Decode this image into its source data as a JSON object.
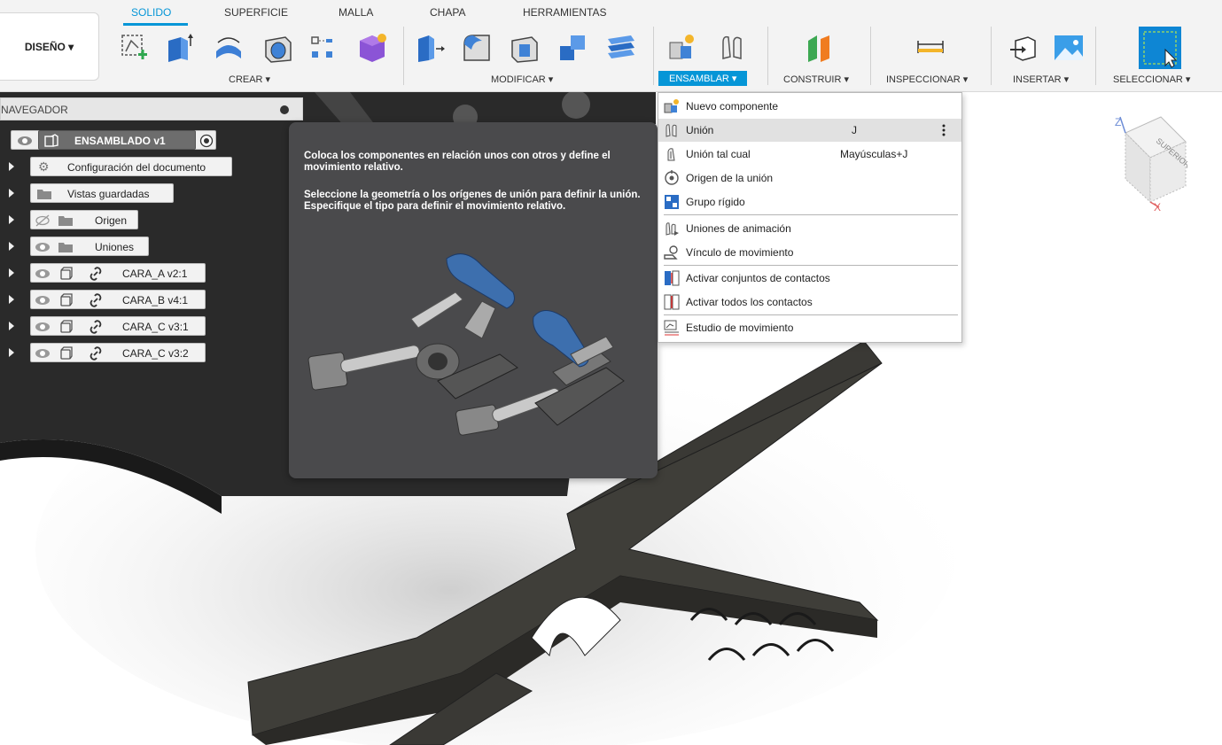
{
  "tabs": [
    {
      "id": "solido",
      "label": "SOLIDO",
      "active": true
    },
    {
      "id": "superficie",
      "label": "SUPERFICIE"
    },
    {
      "id": "malla",
      "label": "MALLA"
    },
    {
      "id": "chapa",
      "label": "CHAPA"
    },
    {
      "id": "herramientas",
      "label": "HERRAMIENTAS"
    }
  ],
  "design_button": "DISEÑO ▾",
  "groups": {
    "crear": "CREAR ▾",
    "modificar": "MODIFICAR ▾",
    "ensamblar": "ENSAMBLAR ▾",
    "construir": "CONSTRUIR ▾",
    "inspeccionar": "INSPECCIONAR ▾",
    "insertar": "INSERTAR ▾",
    "seleccionar": "SELECCIONAR ▾"
  },
  "accent_color": "#0696d7",
  "navigator": {
    "title": "NAVEGADOR",
    "root": "ENSAMBLADO v1",
    "items": [
      {
        "label": "Configuración del documento",
        "icon": "gear-icon"
      },
      {
        "label": "Vistas guardadas",
        "icon": "folder-icon"
      },
      {
        "label": "Origen",
        "icon": "folder-icon",
        "hidden": true
      },
      {
        "label": "Uniones",
        "icon": "folder-icon"
      },
      {
        "label": "CARA_A v2:1",
        "icon": "component-icon"
      },
      {
        "label": "CARA_B v4:1",
        "icon": "component-icon"
      },
      {
        "label": "CARA_C v3:1",
        "icon": "component-icon"
      },
      {
        "label": "CARA_C v3:2",
        "icon": "component-icon"
      }
    ]
  },
  "tooltip": {
    "line1": "Coloca los componentes en relación unos con otros y define el movimiento relativo.",
    "line2": "Seleccione la geometría o los orígenes de unión para definir la unión. Especifique el tipo para definir el movimiento relativo."
  },
  "menu": {
    "items": [
      {
        "label": "Nuevo componente",
        "icon": "new-component-icon"
      },
      {
        "label": "Unión",
        "shortcut": "J",
        "icon": "joint-icon",
        "highlighted": true
      },
      {
        "label": "Unión tal cual",
        "shortcut": "Mayúsculas+J",
        "icon": "as-built-joint-icon"
      },
      {
        "label": "Origen de la unión",
        "icon": "joint-origin-icon"
      },
      {
        "label": "Grupo rígido",
        "icon": "rigid-group-icon"
      },
      {
        "label": "Uniones de animación",
        "icon": "drive-joints-icon"
      },
      {
        "label": "Vínculo de movimiento",
        "icon": "motion-link-icon"
      },
      {
        "label": "Activar conjuntos de contactos",
        "icon": "contact-sets-icon"
      },
      {
        "label": "Activar todos los contactos",
        "icon": "all-contacts-icon"
      },
      {
        "label": "Estudio de movimiento",
        "icon": "motion-study-icon"
      }
    ]
  },
  "viewcube": {
    "face": "SUPERIOR",
    "axis_z": "Z",
    "axis_x": "X"
  }
}
